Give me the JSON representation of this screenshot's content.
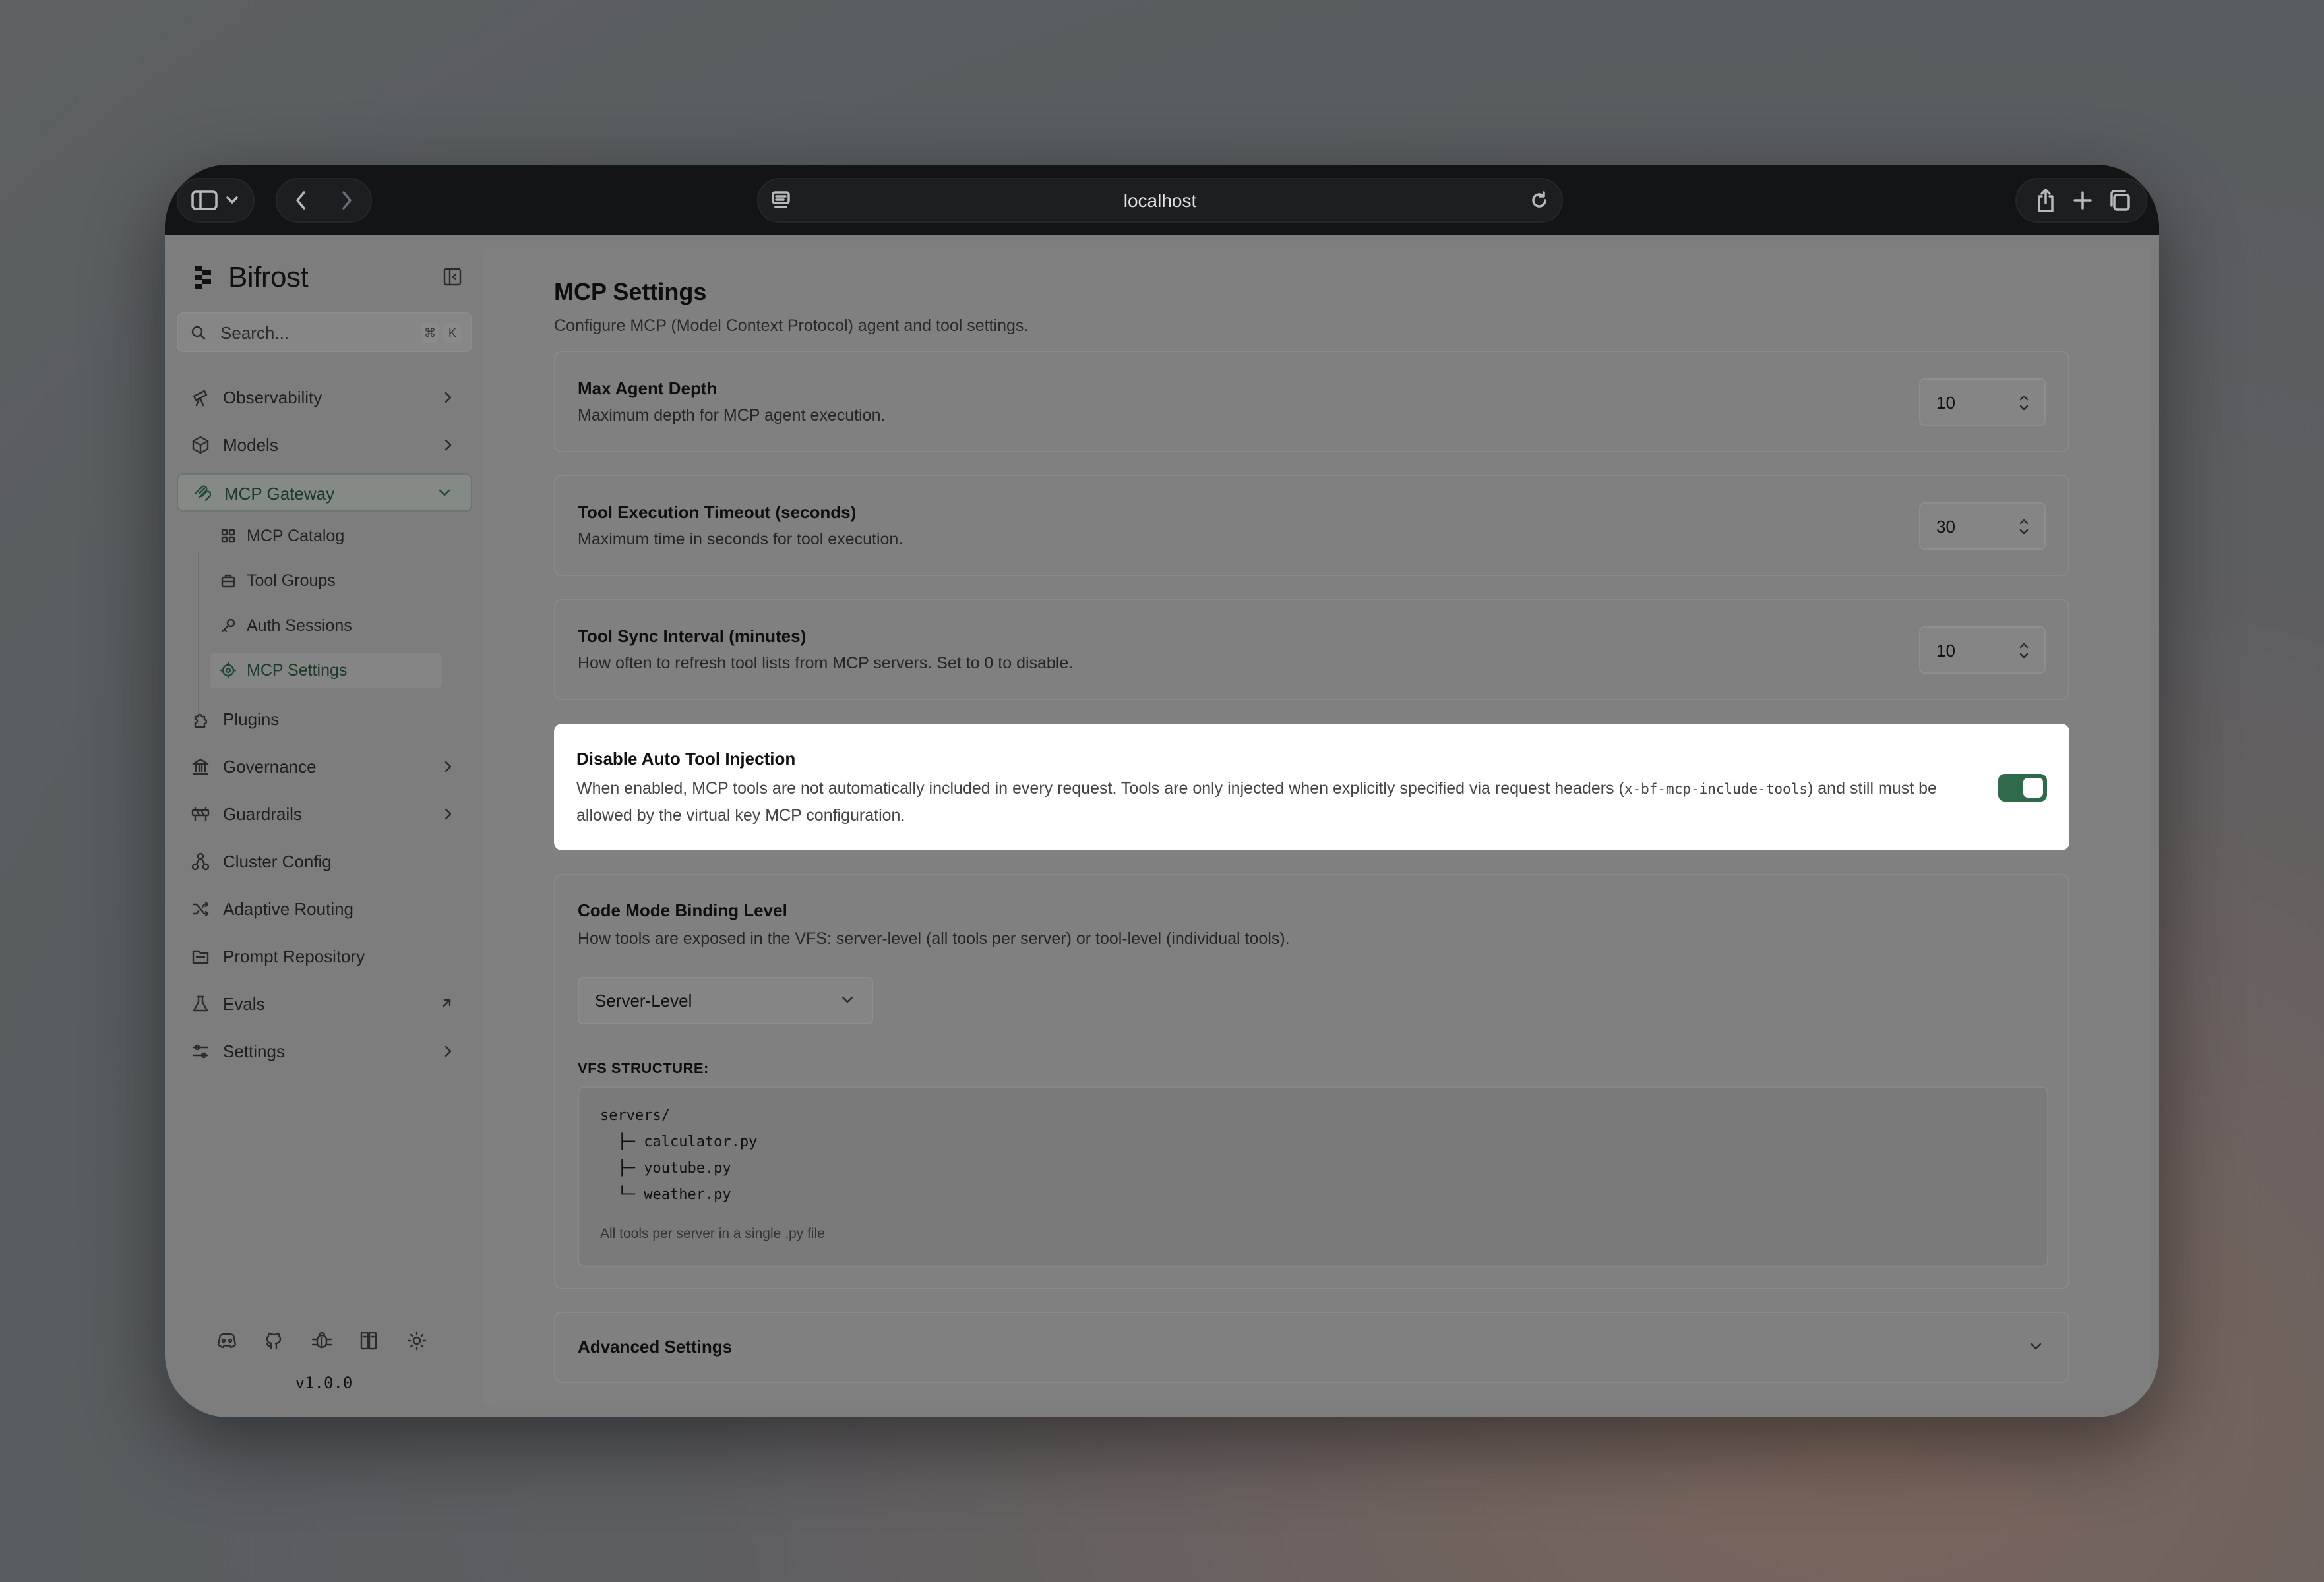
{
  "browser": {
    "url": "localhost",
    "icons": [
      "sidebar-toggle-icon",
      "chevron-down-icon",
      "back-icon",
      "forward-icon",
      "reader-icon",
      "reload-icon",
      "share-icon",
      "new-tab-icon",
      "tabs-overview-icon"
    ]
  },
  "sidebar": {
    "brand": "Bifrost",
    "search_placeholder": "Search...",
    "shortcut_keys": [
      "⌘",
      "K"
    ],
    "items": [
      {
        "label": "Observability",
        "icon": "telescope-icon",
        "has_chevron": true
      },
      {
        "label": "Models",
        "icon": "cube-icon",
        "has_chevron": true
      },
      {
        "label": "MCP Gateway",
        "icon": "mcp-icon",
        "expanded": true
      },
      {
        "label": "Plugins",
        "icon": "puzzle-icon"
      },
      {
        "label": "Governance",
        "icon": "bank-icon",
        "has_chevron": true
      },
      {
        "label": "Guardrails",
        "icon": "barrier-icon",
        "has_chevron": true
      },
      {
        "label": "Cluster Config",
        "icon": "network-icon"
      },
      {
        "label": "Adaptive Routing",
        "icon": "shuffle-icon"
      },
      {
        "label": "Prompt Repository",
        "icon": "folder-icon"
      },
      {
        "label": "Evals",
        "icon": "flask-icon",
        "external": true
      },
      {
        "label": "Settings",
        "icon": "sliders-icon",
        "has_chevron": true
      }
    ],
    "sub_items": [
      {
        "label": "MCP Catalog",
        "icon": "grid-icon"
      },
      {
        "label": "Tool Groups",
        "icon": "toolbox-icon"
      },
      {
        "label": "Auth Sessions",
        "icon": "key-icon"
      },
      {
        "label": "MCP Settings",
        "icon": "gear-icon",
        "active": true
      }
    ],
    "footer_icons": [
      "discord-icon",
      "github-icon",
      "bug-icon",
      "docs-icon",
      "theme-icon"
    ],
    "version": "v1.0.0"
  },
  "main": {
    "title": "MCP Settings",
    "subtitle": "Configure MCP (Model Context Protocol) agent and tool settings.",
    "max_agent_depth": {
      "title": "Max Agent Depth",
      "description": "Maximum depth for MCP agent execution.",
      "value": "10"
    },
    "tool_timeout": {
      "title": "Tool Execution Timeout (seconds)",
      "description": "Maximum time in seconds for tool execution.",
      "value": "30"
    },
    "tool_sync": {
      "title": "Tool Sync Interval (minutes)",
      "description": "How often to refresh tool lists from MCP servers. Set to 0 to disable.",
      "value": "10"
    },
    "disable_auto_injection": {
      "title": "Disable Auto Tool Injection",
      "description_before": "When enabled, MCP tools are not automatically included in every request. Tools are only injected when explicitly specified via request headers (",
      "header_code": "x-bf-mcp-include-tools",
      "description_after": ") and still must be allowed by the virtual key MCP configuration.",
      "enabled": true,
      "accent": "#2f6a4a"
    },
    "code_mode": {
      "title": "Code Mode Binding Level",
      "description": "How tools are exposed in the VFS: server-level (all tools per server) or tool-level (individual tools).",
      "selected": "Server-Level",
      "vfs_label": "VFS STRUCTURE:",
      "vfs_lines": [
        "servers/",
        "  ├─ calculator.py",
        "  ├─ youtube.py",
        "  └─ weather.py"
      ],
      "vfs_note": "All tools per server in a single .py file"
    },
    "advanced": {
      "title": "Advanced Settings"
    }
  }
}
